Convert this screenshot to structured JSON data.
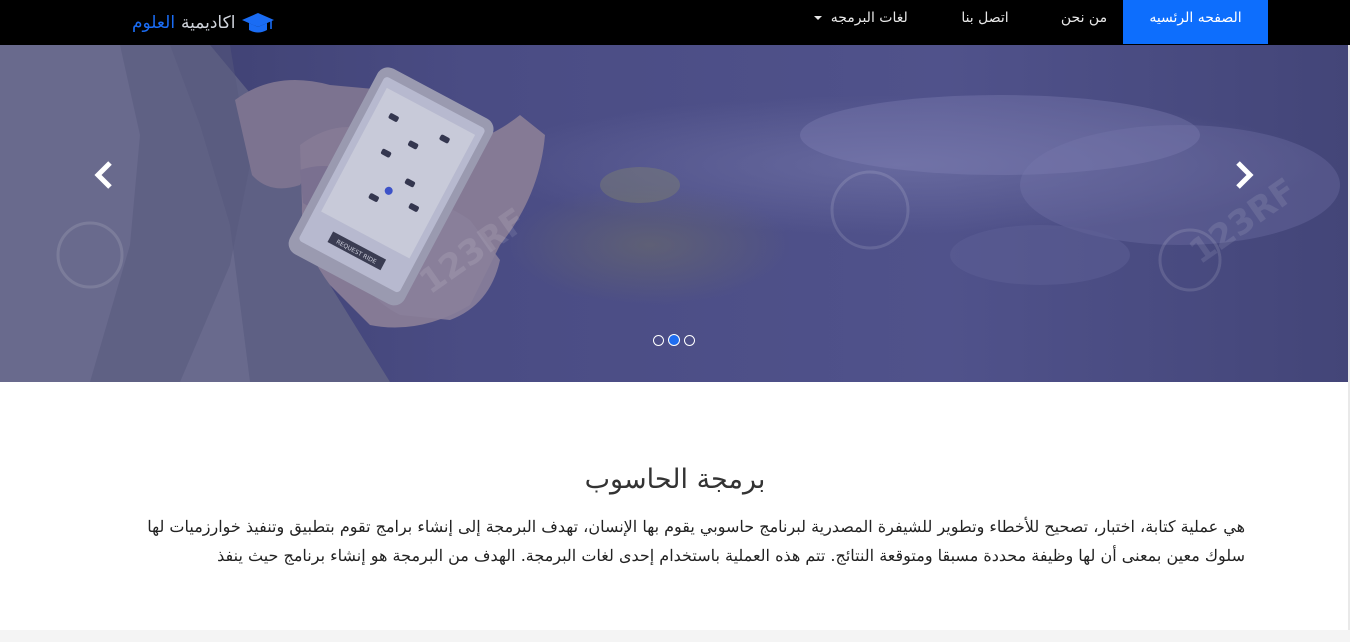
{
  "brand": {
    "part1": "اكاديمية",
    "part2": "العلوم",
    "icon": "graduation-cap-icon",
    "accent_color": "#1a6cf4"
  },
  "nav": {
    "items": [
      {
        "label": "الصفحه الرئسيه",
        "active": true
      },
      {
        "label": "من نحن",
        "active": false
      },
      {
        "label": "اتصل بنا",
        "active": false
      },
      {
        "label": "لغات البرمجه",
        "active": false,
        "dropdown": true
      }
    ],
    "active_color": "#0d6efd"
  },
  "carousel": {
    "slide_count": 3,
    "active_index": 1,
    "prev_icon": "chevron-left-icon",
    "next_icon": "chevron-right-icon",
    "phone_screen_label": "REQUEST RIDE"
  },
  "article": {
    "title": "برمجة الحاسوب",
    "body": "هي عملية كتابة، اختبار، تصحيح للأخطاء وتطوير للشيفرة المصدرية لبرنامج حاسوبي يقوم بها الإنسان، تهدف البرمجة إلى إنشاء برامج تقوم بتطبيق وتنفيذ خوارزميات لها سلوك معين بمعنى أن لها وظيفة محددة مسبقا ومتوقعة النتائج. تتم هذه العملية باستخدام إحدى لغات البرمجة. الهدف من البرمجة هو إنشاء برنامج حيث ينفذ"
  }
}
